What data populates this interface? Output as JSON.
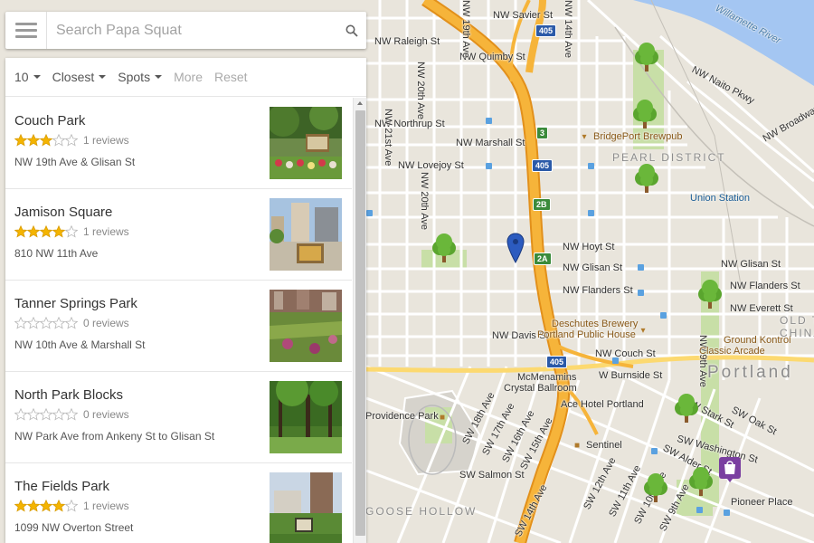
{
  "search": {
    "placeholder": "Search Papa Squat",
    "menu_icon": "hamburger-menu-icon",
    "search_icon": "magnifier-search-icon"
  },
  "filters": {
    "count": "10",
    "sort": "Closest",
    "type": "Spots",
    "more": "More",
    "reset": "Reset"
  },
  "parks": [
    {
      "name": "Couch Park",
      "stars": 3,
      "reviews": "1 reviews",
      "address": "NW 19th Ave & Glisan St"
    },
    {
      "name": "Jamison Square",
      "stars": 4,
      "reviews": "1 reviews",
      "address": "810 NW 11th Ave"
    },
    {
      "name": "Tanner Springs Park",
      "stars": 0,
      "reviews": "0 reviews",
      "address": "NW 10th Ave & Marshall St"
    },
    {
      "name": "North Park Blocks",
      "stars": 0,
      "reviews": "0 reviews",
      "address": "NW Park Ave from Ankeny St to Glisan St"
    },
    {
      "name": "The Fields Park",
      "stars": 4,
      "reviews": "1 reviews",
      "address": "1099 NW Overton Street"
    }
  ],
  "map": {
    "streets": {
      "savier": "NW Savier St",
      "raleigh": "NW Raleigh St",
      "quimby": "NW Quimby St",
      "northrup": "NW Northrup St",
      "marshall": "NW Marshall St",
      "lovejoy": "NW Lovejoy St",
      "hoyt": "NW Hoyt St",
      "glisan": "NW Glisan St",
      "glisan_east": "NW Glisan St",
      "flanders": "NW Flanders St",
      "flanders_east": "NW Flanders St",
      "everett": "NW Everett St",
      "davis": "NW Davis St",
      "couch": "NW Couch St",
      "burnside": "W Burnside St",
      "salmon": "SW Salmon St",
      "alder": "SW Alder St",
      "washington": "SW Washington St",
      "oak": "SW Oak St",
      "stark": "SW Stark St",
      "ave19": "NW 19th Ave",
      "ave20": "NW 20th Ave",
      "ave21": "NW 21st Ave",
      "ave14": "NW 14th Ave",
      "ave9": "NW 9th Ave",
      "sw18": "SW 18th Ave",
      "sw17": "SW 17th Ave",
      "sw16": "SW 16th Ave",
      "sw15": "SW 15th Ave",
      "sw14": "SW 14th Ave",
      "sw12": "SW 12th Ave",
      "sw11": "SW 11th Ave",
      "sw10": "SW 10th Ave",
      "sw9": "SW 9th Ave",
      "naito": "NW Naito Pkwy",
      "broadway": "NW Broadway",
      "river": "Willamette River"
    },
    "places": {
      "bridgeport": "BridgePort Brewpub",
      "pearl": "PEARL DISTRICT",
      "union": "Union Station",
      "deschutes_1": "Deschutes Brewery",
      "deschutes_2": "Portland Public House",
      "mcmenamins_1": "McMenamins",
      "mcmenamins_2": "Crystal Ballroom",
      "ace": "Ace Hotel Portland",
      "sentinel": "Sentinel",
      "providence": "Providence Park",
      "goose": "GOOSE HOLLOW",
      "ground_1": "Ground Kontrol",
      "ground_2": "Classic Arcade",
      "old_town_1": "OLD TO",
      "old_town_2": "CHINA",
      "portland": "Portland",
      "pioneer": "Pioneer Place"
    },
    "shields": {
      "i405_top": "405",
      "i405_mid": "405",
      "i405_bottom": "405",
      "exit3": "3",
      "exit2b": "2B",
      "exit2a": "2A"
    },
    "colors": {
      "freeway": "#f4a21f",
      "park": "#c8dfa7",
      "water": "#a4c6f2",
      "tree_marker": "#6ab73a",
      "pin": "#2c5bbf",
      "shopping_marker": "#7a3fa0"
    }
  }
}
